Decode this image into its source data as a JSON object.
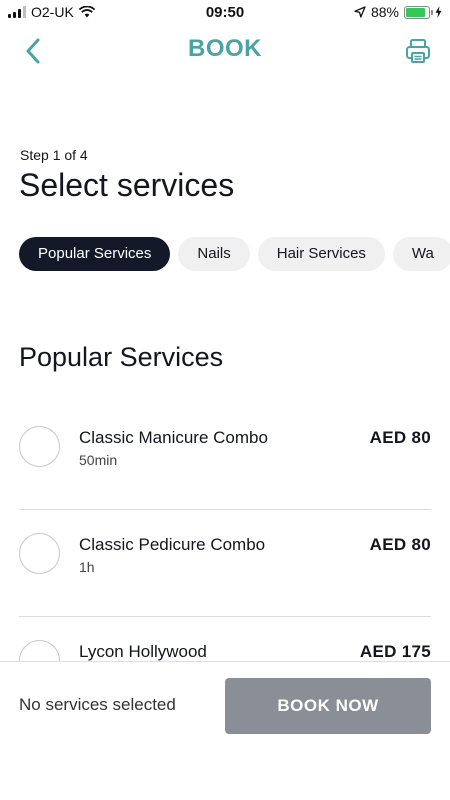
{
  "status_bar": {
    "carrier": "O2-UK",
    "time": "09:50",
    "battery": "88%",
    "battery_level": 0.88,
    "battery_color": "#35c759"
  },
  "header": {
    "title": "BOOK",
    "back_icon": "chevron-left-icon",
    "print_icon": "printer-icon",
    "accent_color": "#4aa3a5"
  },
  "step_label": "Step 1 of 4",
  "page_title": "Select services",
  "categories": [
    {
      "label": "Popular Services",
      "active": true
    },
    {
      "label": "Nails",
      "active": false
    },
    {
      "label": "Hair Services",
      "active": false
    },
    {
      "label": "Wa",
      "active": false
    }
  ],
  "section_title": "Popular Services",
  "services": [
    {
      "name": "Classic Manicure Combo",
      "duration": "50min",
      "price": "AED 80"
    },
    {
      "name": "Classic Pedicure Combo",
      "duration": "1h",
      "price": "AED 80"
    },
    {
      "name": "Lycon Hollywood",
      "duration": "",
      "price": "AED 175"
    }
  ],
  "footer": {
    "status": "No services selected",
    "book_label": "BOOK NOW",
    "button_color": "#8a8e97"
  }
}
